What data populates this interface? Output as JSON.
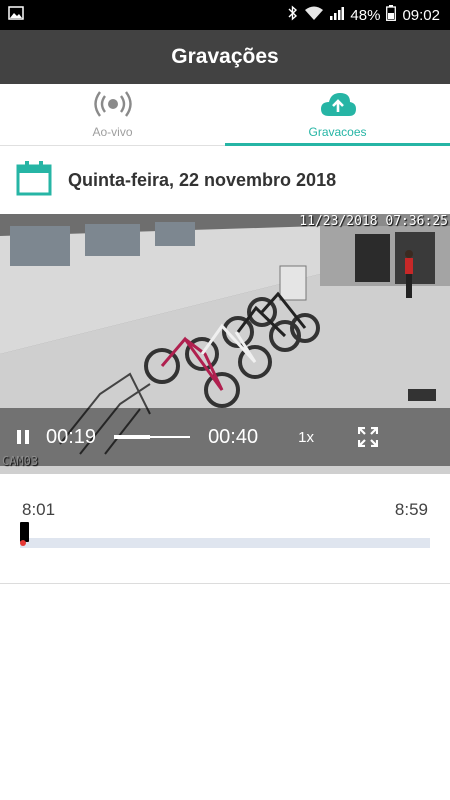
{
  "status_bar": {
    "battery": "48%",
    "time": "09:02"
  },
  "app_bar": {
    "title": "Gravações"
  },
  "tabs": [
    {
      "label": "Ao-vivo",
      "active": false
    },
    {
      "label": "Gravacoes",
      "active": true
    }
  ],
  "date_header": {
    "text": "Quinta-feira, 22 novembro 2018"
  },
  "video": {
    "timestamp": "11/23/2018 07:36:25",
    "camera_name": "CAM03",
    "current_time": "00:19",
    "duration": "00:40",
    "speed": "1x",
    "progress": 0.475
  },
  "timeline": {
    "start": "8:01",
    "end": "8:59",
    "position": 0.0
  },
  "colors": {
    "accent": "#26b5a5",
    "appbar": "#424242",
    "track": "#dfe5ef"
  }
}
